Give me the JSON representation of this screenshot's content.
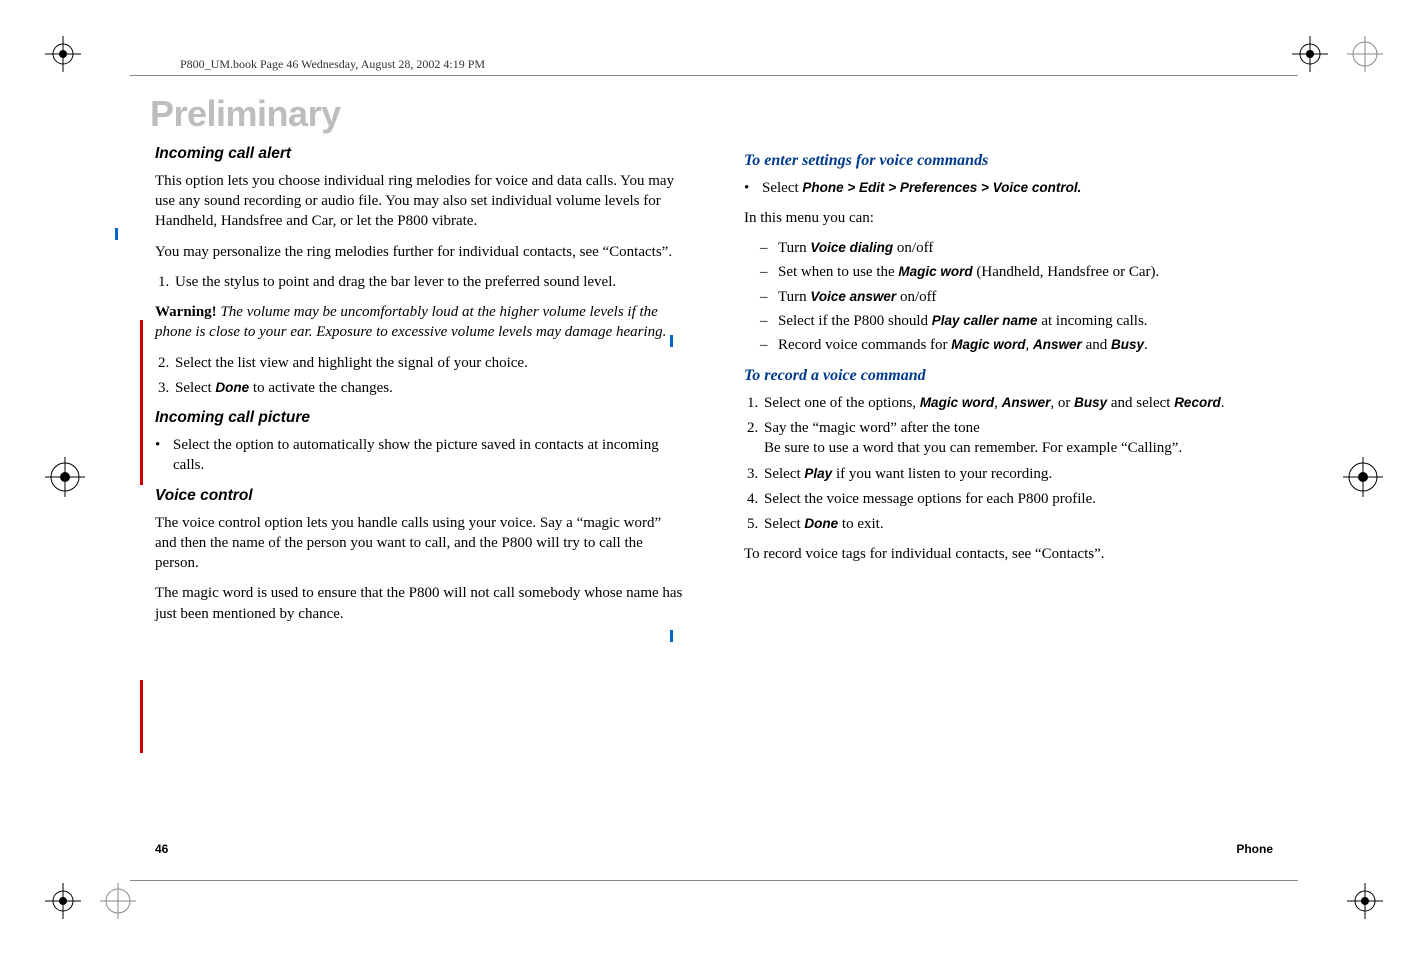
{
  "header": {
    "running": "P800_UM.book  Page 46  Wednesday, August 28, 2002  4:19 PM"
  },
  "watermark": "Preliminary",
  "left": {
    "h_incoming_alert": "Incoming call alert",
    "p_alert_1": "This option lets you choose individual ring melodies for voice and data calls. You may use any sound recording or audio file. You may also set individual volume levels for Handheld, Handsfree and Car, or let the P800 vibrate.",
    "p_alert_2": "You may personalize the ring melodies further for individual contacts, see “Contacts”.",
    "step_alert_1": "Use the stylus to point and drag the bar lever to the preferred sound level.",
    "warn_label": "Warning!",
    "warn_body": " The volume may be uncomfortably loud at the higher volume levels if the phone is close to your ear. Exposure to excessive volume levels may damage hearing.",
    "step_alert_2": "Select the list view and highlight the signal of your choice.",
    "step_alert_3_a": "Select ",
    "step_alert_3_done": "Done",
    "step_alert_3_b": " to activate the changes.",
    "h_incoming_pic": "Incoming call picture",
    "bullet_pic": "Select the option to automatically show the picture saved in contacts at incoming calls.",
    "h_voice_ctrl": "Voice control",
    "p_voice_1": "The voice control option lets you handle calls using your voice. Say a “magic word” and then the name of the person you want to call, and the P800 will try to call the person.",
    "p_voice_2": "The magic word is used to ensure that the P800 will not call somebody whose name has just been mentioned by chance."
  },
  "right": {
    "h_enter_settings": "To enter settings for voice commands",
    "bullet_sel_a": "Select ",
    "bullet_sel_path": "Phone > Edit > Preferences > Voice control.",
    "p_menu_can": "In this menu you can:",
    "d1_a": "Turn ",
    "d1_term": "Voice dialing",
    "d1_b": " on/off",
    "d2_a": "Set when to use the ",
    "d2_term": "Magic word",
    "d2_b": " (Handheld, Handsfree or Car).",
    "d3_a": "Turn ",
    "d3_term": "Voice answer",
    "d3_b": " on/off",
    "d4_a": "Select if the P800 should ",
    "d4_term": "Play caller name",
    "d4_b": " at incoming calls.",
    "d5_a": "Record voice commands for ",
    "d5_t1": "Magic word",
    "d5_sep1": ", ",
    "d5_t2": "Answer",
    "d5_sep2": " and ",
    "d5_t3": "Busy",
    "d5_end": ".",
    "h_record": "To record a voice command",
    "s1_a": "Select one of the options, ",
    "s1_t1": "Magic word",
    "s1_sep1": ", ",
    "s1_t2": "Answer",
    "s1_sep2": ", or ",
    "s1_t3": "Busy",
    "s1_b": " and select ",
    "s1_t4": "Record",
    "s1_end": ".",
    "s2_a": "Say the “magic word” after the tone",
    "s2_b": "Be sure to use a word that you can remember. For example “Calling”.",
    "s3_a": "Select ",
    "s3_term": "Play",
    "s3_b": " if you want listen to your recording.",
    "s4": "Select the voice message options for each P800 profile.",
    "s5_a": "Select ",
    "s5_term": "Done",
    "s5_b": " to exit.",
    "p_record_tags": "To record voice tags for individual contacts, see “Contacts”."
  },
  "footer": {
    "page": "46",
    "section": "Phone"
  }
}
